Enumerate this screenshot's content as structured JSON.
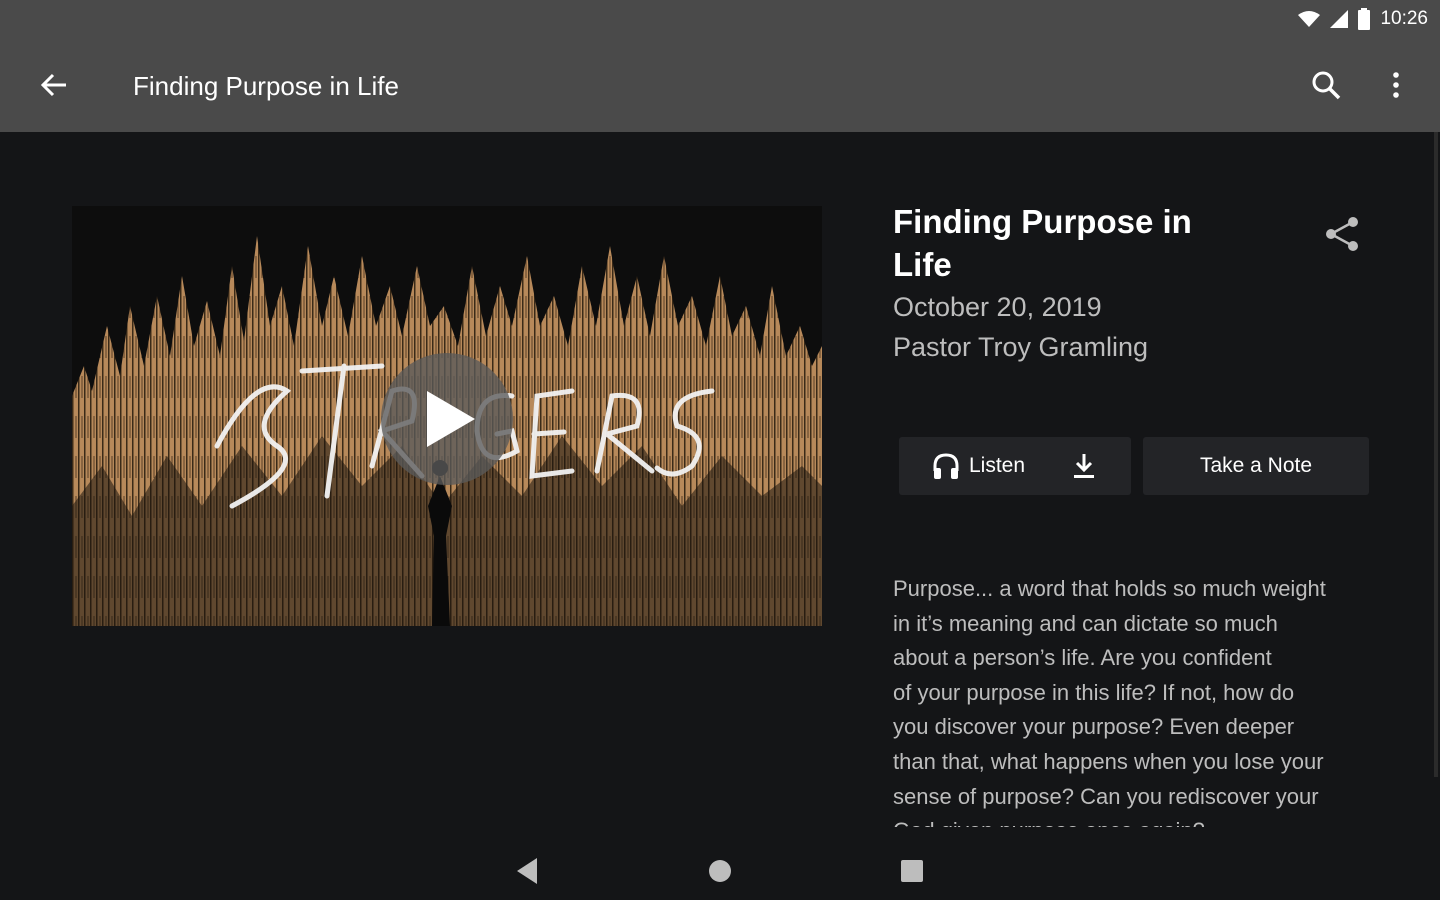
{
  "status_bar": {
    "time": "10:26",
    "icons": [
      "wifi-icon",
      "cell-signal-icon",
      "battery-icon"
    ]
  },
  "app_bar": {
    "title": "Finding Purpose in Life",
    "back_icon": "arrow-left-icon",
    "search_icon": "search-icon",
    "more_icon": "more-vertical-icon"
  },
  "media": {
    "artwork_description_icon": "play-icon",
    "colors": {
      "trees": "#b7895a",
      "background": "#0d0d0d"
    }
  },
  "sermon": {
    "title": "Finding Purpose in Life",
    "date": "October 20, 2019",
    "speaker": "Pastor Troy Gramling",
    "description": "Purpose... a word that holds so much weight\nin it’s meaning and can dictate so much\nabout a person’s life.  Are you confident\nof your purpose in this life?  If not, how do\nyou discover your purpose?  Even deeper\nthan that, what happens when you lose your\nsense of purpose?  Can you rediscover your\nGod given purpose once again?"
  },
  "actions": {
    "listen_label": "Listen",
    "note_label": "Take a Note"
  },
  "colors": {
    "app_bar": "#4a4a4a",
    "background": "#141517",
    "button": "#232427",
    "secondary_text": "#bdbdbd"
  }
}
